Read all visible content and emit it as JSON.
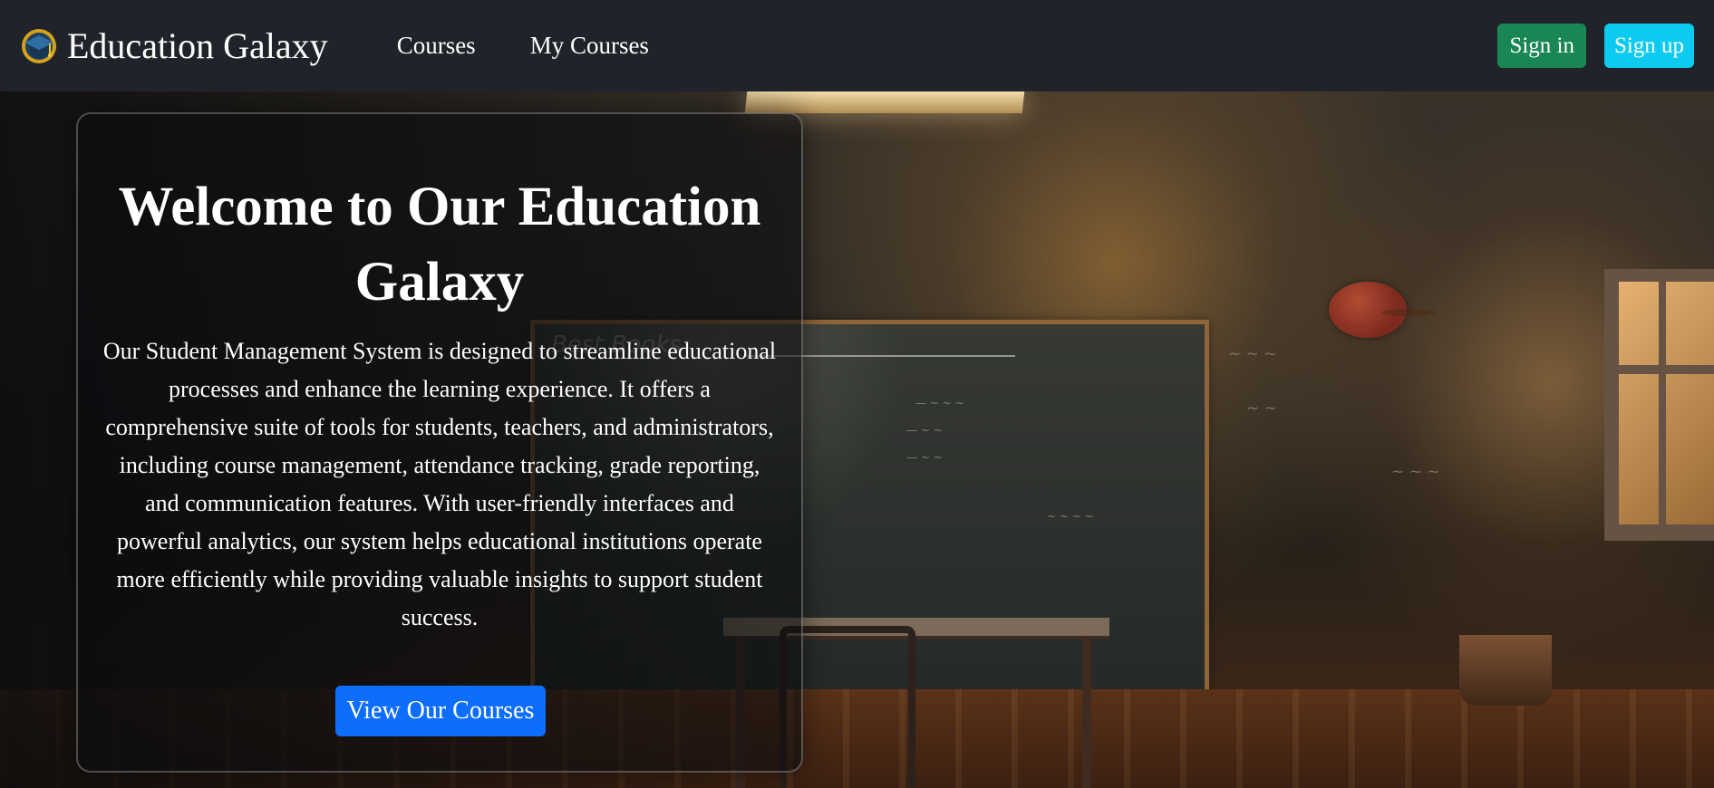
{
  "navbar": {
    "brand_name": "Education Galaxy",
    "brand_icon": "graduation-cap-logo-icon",
    "links": [
      {
        "label": "Courses"
      },
      {
        "label": "My Courses"
      }
    ],
    "buttons": {
      "sign_in": "Sign in",
      "sign_up": "Sign up"
    }
  },
  "hero": {
    "title": "Welcome to Our Education Galaxy",
    "description": "Our Student Management System is designed to streamline educational processes and enhance the learning experience. It offers a comprehensive suite of tools for students, teachers, and administrators, including course management, attendance tracking, grade reporting, and communication features. With user-friendly interfaces and powerful analytics, our system helps educational institutions operate more efficiently while providing valuable insights to support student success.",
    "cta": "View Our Courses"
  },
  "colors": {
    "navbar": "#20242a",
    "sign_in": "#198754",
    "sign_up": "#0dcaf0",
    "cta": "#0d6efd"
  }
}
